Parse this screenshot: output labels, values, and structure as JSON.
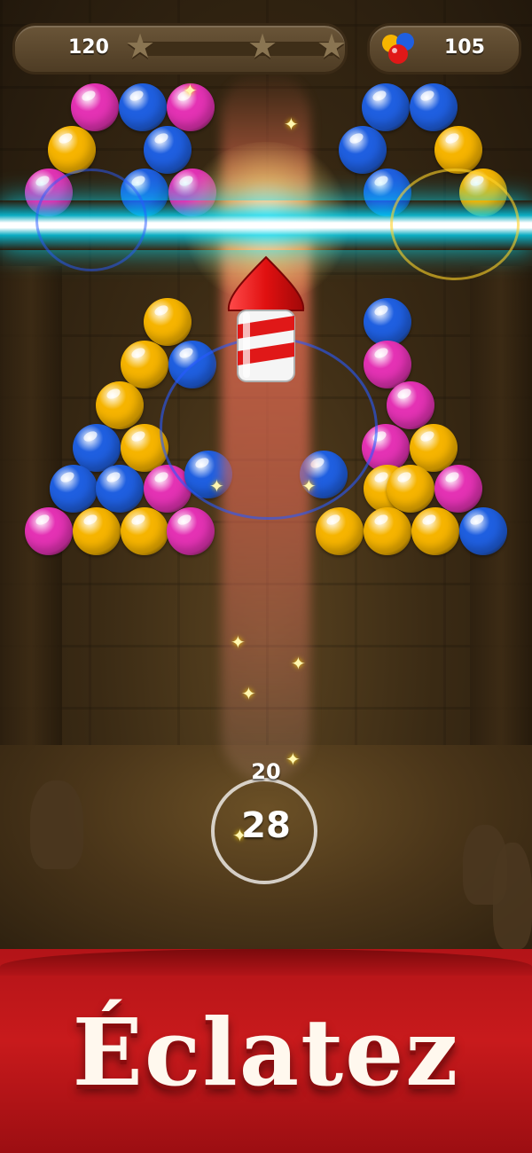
{
  "hud": {
    "score": "120",
    "stars": 3,
    "shots_left": "105",
    "bubble_colors": {
      "yellow": "#f6b400",
      "blue": "#1f5fe0",
      "magenta": "#e432b4"
    }
  },
  "shooter": {
    "current_count": "28",
    "next_count": "20"
  },
  "booster": "rocket",
  "banner": {
    "title": "Éclatez"
  }
}
